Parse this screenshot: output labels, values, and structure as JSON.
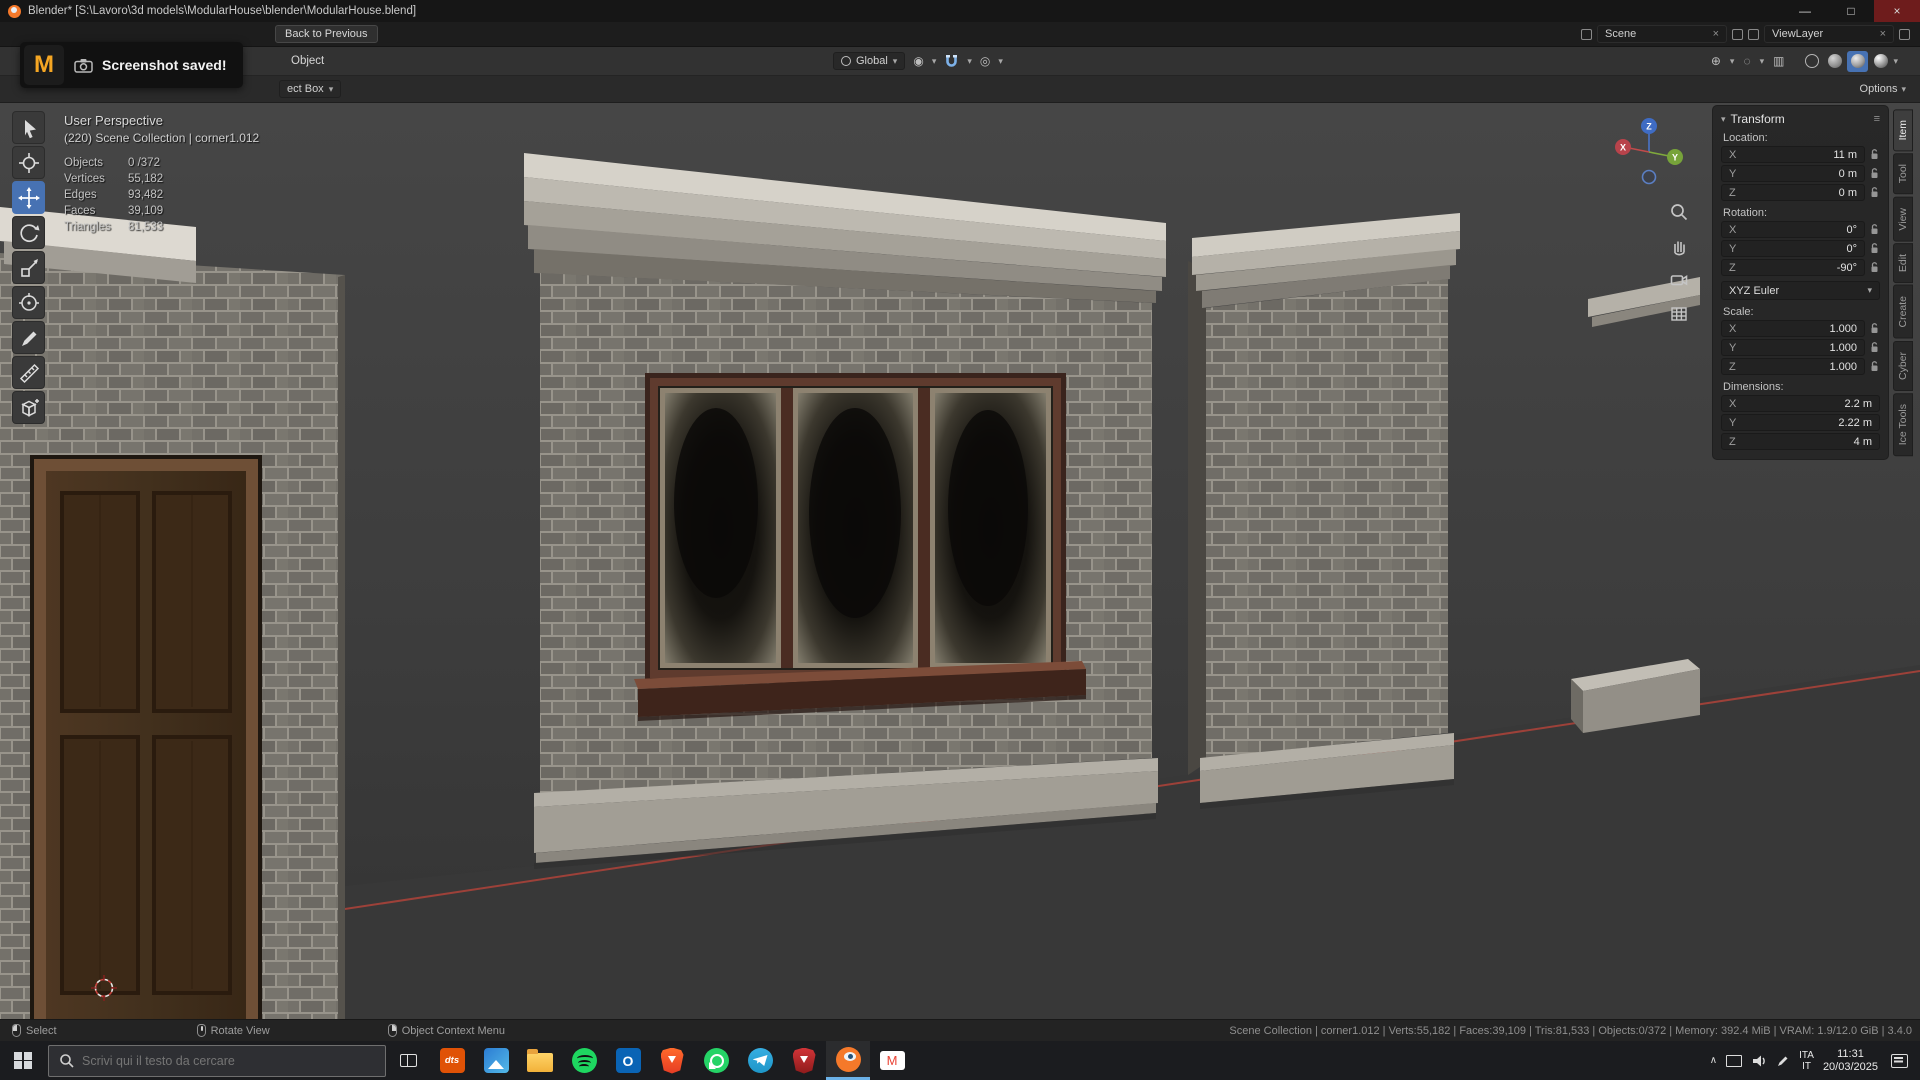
{
  "window": {
    "title": "Blender* [S:\\Lavoro\\3d models\\ModularHouse\\blender\\ModularHouse.blend]",
    "controls": {
      "minimize": "—",
      "maximize": "□",
      "close": "×"
    }
  },
  "icons": {
    "caret": "▾",
    "close": "×",
    "menu": "≡",
    "chevron_up": "∧",
    "prop_edit": "◎",
    "pivot": "◉",
    "gizmo_toggle": "⊕",
    "overlay_toggle": "◌",
    "xray": "▥",
    "blender_app_icon": "blender-logo",
    "search_icon": "magnifier",
    "camera_icon": "camera",
    "magnet_icon": "snap-magnet",
    "lock_icon": "unlocked-padlock"
  },
  "topbar": {
    "back_button": "Back to Previous",
    "scene_label": "Scene",
    "view_layer_label": "ViewLayer"
  },
  "vheader": {
    "object_menu": "Object",
    "orientation": "Global"
  },
  "tool_settings": {
    "active_tool": "ect Box",
    "options": "Options"
  },
  "toast": {
    "app_initial": "M",
    "message": "Screenshot saved!"
  },
  "overlay": {
    "view_name": "User Perspective",
    "breadcrumb": "(220) Scene Collection | corner1.012",
    "stats": [
      {
        "label": "Objects",
        "value": "0 /372"
      },
      {
        "label": "Vertices",
        "value": "55,182"
      },
      {
        "label": "Edges",
        "value": "93,482"
      },
      {
        "label": "Faces",
        "value": "39,109"
      },
      {
        "label": "Triangles",
        "value": "81,533"
      }
    ]
  },
  "gizmo": {
    "x": "X",
    "y": "Y",
    "z": "Z"
  },
  "tools": [
    "tweak-select",
    "cursor",
    "move",
    "rotate",
    "scale",
    "transform",
    "annotate",
    "measure",
    "add-cube"
  ],
  "active_tool": "move",
  "transform": {
    "title": "Transform",
    "location_label": "Location:",
    "loc": [
      {
        "axis": "X",
        "value": "11 m"
      },
      {
        "axis": "Y",
        "value": "0 m"
      },
      {
        "axis": "Z",
        "value": "0 m"
      }
    ],
    "rotation_label": "Rotation:",
    "rot": [
      {
        "axis": "X",
        "value": "0°"
      },
      {
        "axis": "Y",
        "value": "0°"
      },
      {
        "axis": "Z",
        "value": "-90°"
      }
    ],
    "rotation_mode": "XYZ Euler",
    "scale_label": "Scale:",
    "scl": [
      {
        "axis": "X",
        "value": "1.000"
      },
      {
        "axis": "Y",
        "value": "1.000"
      },
      {
        "axis": "Z",
        "value": "1.000"
      }
    ],
    "dimensions_label": "Dimensions:",
    "dim": [
      {
        "axis": "X",
        "value": "2.2 m"
      },
      {
        "axis": "Y",
        "value": "2.22 m"
      },
      {
        "axis": "Z",
        "value": "4 m"
      }
    ]
  },
  "side_tabs": [
    {
      "label": "Item",
      "active": true
    },
    {
      "label": "Tool"
    },
    {
      "label": "View"
    },
    {
      "label": "Edit"
    },
    {
      "label": "Create"
    },
    {
      "label": "Cyber"
    },
    {
      "label": "Ice Tools"
    }
  ],
  "statusbar": {
    "hints": [
      {
        "label": "Select",
        "mouse": "left"
      },
      {
        "label": "Rotate View",
        "mouse": "middle"
      },
      {
        "label": "Object Context Menu",
        "mouse": "right"
      }
    ],
    "info": "Scene Collection | corner1.012 | Verts:55,182 | Faces:39,109 | Tris:81,533 | Objects:0/372 | Memory: 392.4 MiB | VRAM: 1.9/12.0 GiB | 3.4.0"
  },
  "taskbar": {
    "search_placeholder": "Scrivi qui il testo da cercare",
    "apps": [
      "task-view",
      "dts",
      "photos",
      "file-explorer",
      "spotify",
      "outlook",
      "brave",
      "whatsapp",
      "telegram",
      "brave-beta",
      "blender",
      "gmail"
    ],
    "active_app": "blender",
    "dts_label": "dts",
    "outlook_label": "O",
    "gmail_label": "M",
    "tray": {
      "lang_top": "ITA",
      "lang_bottom": "IT",
      "time": "11:31",
      "date": "20/03/2025"
    }
  }
}
